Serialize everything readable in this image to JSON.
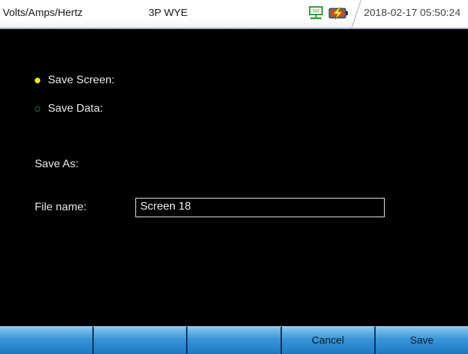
{
  "header": {
    "mode": "Volts/Amps/Hertz",
    "wiring": "3P WYE",
    "datetime": "2018-02-17 05:50:24",
    "icons": {
      "network": "network-icon",
      "battery": "battery-charging-icon"
    }
  },
  "options": {
    "save_screen": {
      "label": "Save Screen:",
      "selected": true
    },
    "save_data": {
      "label": "Save Data:",
      "selected": false
    }
  },
  "save_as": {
    "label": "Save As:"
  },
  "file_name": {
    "label": "File name:",
    "value": "Screen 18"
  },
  "softkeys": [
    "",
    "",
    "",
    "Cancel",
    "Save"
  ],
  "colors": {
    "radio_selected": "#f2ea1e",
    "radio_unselected": "#1f7a1f",
    "softkey": "#3a95d8",
    "background": "#000000"
  }
}
